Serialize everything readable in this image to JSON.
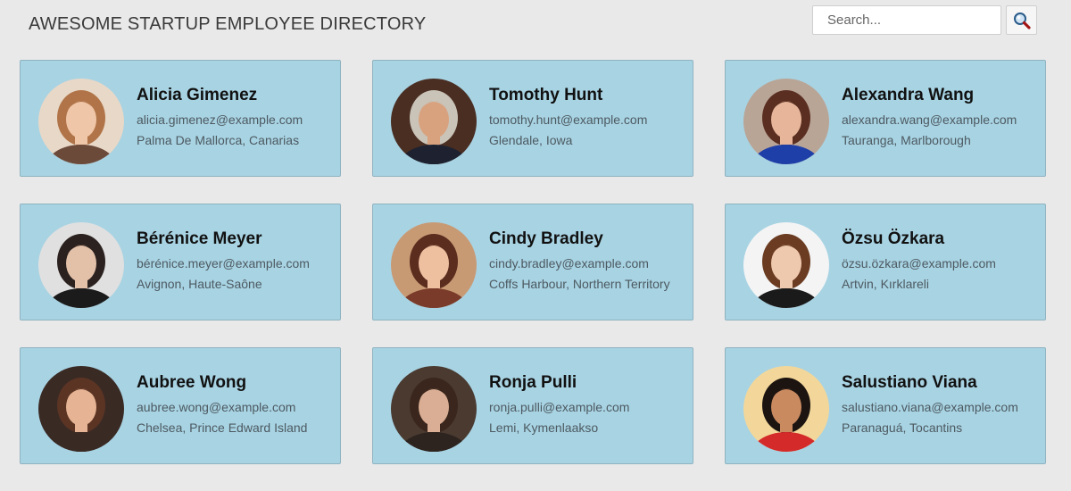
{
  "header": {
    "title": "AWESOME STARTUP EMPLOYEE DIRECTORY"
  },
  "search": {
    "placeholder": "Search...",
    "button_icon": "magnifier-icon"
  },
  "employees": [
    {
      "name": "Alicia Gimenez",
      "email": "alicia.gimenez@example.com",
      "location": "Palma De Mallorca, Canarias",
      "avatar_colors": {
        "bg": "#e8d8c8",
        "hair": "#b07448",
        "skin": "#f0c6a8",
        "clothes": "#6c4a3a"
      }
    },
    {
      "name": "Tomothy Hunt",
      "email": "tomothy.hunt@example.com",
      "location": "Glendale, Iowa",
      "avatar_colors": {
        "bg": "#4a2e22",
        "hair": "#c9c3b8",
        "skin": "#d9a27f",
        "clothes": "#1e2230"
      }
    },
    {
      "name": "Alexandra Wang",
      "email": "alexandra.wang@example.com",
      "location": "Tauranga, Marlborough",
      "avatar_colors": {
        "bg": "#b9a596",
        "hair": "#5a2f22",
        "skin": "#e7b69a",
        "clothes": "#1f3fa8"
      }
    },
    {
      "name": "Bérénice Meyer",
      "email": "bérénice.meyer@example.com",
      "location": "Avignon, Haute-Saône",
      "avatar_colors": {
        "bg": "#e0e0e0",
        "hair": "#2b211e",
        "skin": "#e3c0a8",
        "clothes": "#1b1b1b"
      }
    },
    {
      "name": "Cindy Bradley",
      "email": "cindy.bradley@example.com",
      "location": "Coffs Harbour, Northern Territory",
      "avatar_colors": {
        "bg": "#c89a74",
        "hair": "#5a2d1e",
        "skin": "#eec0a0",
        "clothes": "#7a3b2a"
      }
    },
    {
      "name": "Özsu Özkara",
      "email": "özsu.özkara@example.com",
      "location": "Artvin, Kırklareli",
      "avatar_colors": {
        "bg": "#f4f4f4",
        "hair": "#6b3c22",
        "skin": "#efc9ae",
        "clothes": "#1a1a1a"
      }
    },
    {
      "name": "Aubree Wong",
      "email": "aubree.wong@example.com",
      "location": "Chelsea, Prince Edward Island",
      "avatar_colors": {
        "bg": "#3a2a24",
        "hair": "#5b3424",
        "skin": "#e6b494",
        "clothes": "#3a2a24"
      }
    },
    {
      "name": "Ronja Pulli",
      "email": "ronja.pulli@example.com",
      "location": "Lemi, Kymenlaakso",
      "avatar_colors": {
        "bg": "#4a3a30",
        "hair": "#3a261c",
        "skin": "#d9ae94",
        "clothes": "#2d2420"
      }
    },
    {
      "name": "Salustiano Viana",
      "email": "salustiano.viana@example.com",
      "location": "Paranaguá, Tocantins",
      "avatar_colors": {
        "bg": "#f3d79a",
        "hair": "#1c1410",
        "skin": "#c98a60",
        "clothes": "#d42a2a"
      }
    }
  ]
}
